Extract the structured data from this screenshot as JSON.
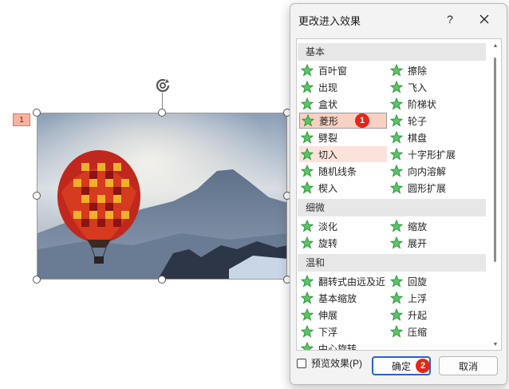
{
  "slide": {
    "animation_tag": "1"
  },
  "dialog": {
    "title": "更改进入效果",
    "help_label": "?",
    "sections": [
      {
        "header": "基本",
        "items": [
          {
            "label": "百叶窗",
            "col": 0
          },
          {
            "label": "擦除",
            "col": 1
          },
          {
            "label": "出现",
            "col": 0
          },
          {
            "label": "飞入",
            "col": 1
          },
          {
            "label": "盒状",
            "col": 0
          },
          {
            "label": "阶梯状",
            "col": 1
          },
          {
            "label": "菱形",
            "col": 0,
            "state": "selected"
          },
          {
            "label": "轮子",
            "col": 1
          },
          {
            "label": "劈裂",
            "col": 0
          },
          {
            "label": "棋盘",
            "col": 1
          },
          {
            "label": "切入",
            "col": 0,
            "state": "hover"
          },
          {
            "label": "十字形扩展",
            "col": 1
          },
          {
            "label": "随机线条",
            "col": 0
          },
          {
            "label": "向内溶解",
            "col": 1
          },
          {
            "label": "楔入",
            "col": 0
          },
          {
            "label": "圆形扩展",
            "col": 1
          }
        ]
      },
      {
        "header": "细微",
        "items": [
          {
            "label": "淡化",
            "col": 0
          },
          {
            "label": "缩放",
            "col": 1
          },
          {
            "label": "旋转",
            "col": 0
          },
          {
            "label": "展开",
            "col": 1
          }
        ]
      },
      {
        "header": "温和",
        "items": [
          {
            "label": "翻转式由远及近",
            "col": 0
          },
          {
            "label": "回旋",
            "col": 1
          },
          {
            "label": "基本缩放",
            "col": 0
          },
          {
            "label": "上浮",
            "col": 1
          },
          {
            "label": "伸展",
            "col": 0
          },
          {
            "label": "升起",
            "col": 1
          },
          {
            "label": "下浮",
            "col": 0
          },
          {
            "label": "压缩",
            "col": 1
          },
          {
            "label": "中心旋转",
            "col": 0
          }
        ]
      }
    ],
    "step_badges": {
      "select": "1",
      "confirm": "2"
    },
    "preview_label": "预览效果(P)",
    "ok_label": "确定",
    "cancel_label": "取消"
  },
  "colors": {
    "star_green": "#2e9b3a",
    "selected_bg": "#f9d0c4",
    "badge_red": "#e2261b",
    "ok_border": "#2a62c9"
  }
}
